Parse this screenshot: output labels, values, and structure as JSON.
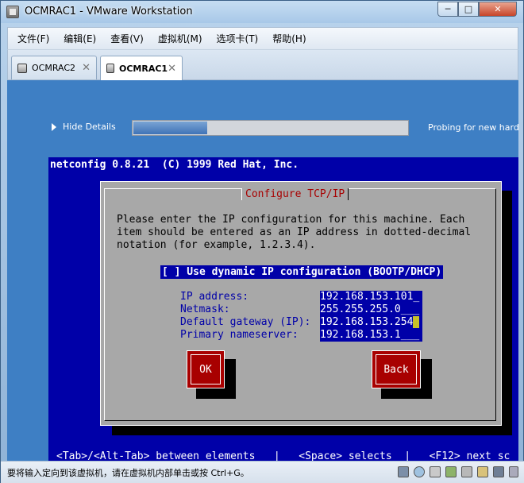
{
  "window": {
    "title": "OCMRAC1 - VMware Workstation",
    "min_glyph": "─",
    "max_glyph": "□",
    "close_glyph": "✕"
  },
  "menu": [
    {
      "label": "文件(F)"
    },
    {
      "label": "编辑(E)"
    },
    {
      "label": "查看(V)"
    },
    {
      "label": "虚拟机(M)"
    },
    {
      "label": "选项卡(T)"
    },
    {
      "label": "帮助(H)"
    }
  ],
  "tabs": [
    {
      "label": "OCMRAC2",
      "active": false,
      "close_glyph": "✕"
    },
    {
      "label": "OCMRAC1",
      "active": true,
      "close_glyph": "✕"
    }
  ],
  "installer": {
    "hide_details_label": "Hide Details",
    "progress_fraction": 0.27,
    "probe_text": "Probing for new hardwa"
  },
  "console": {
    "header": "netconfig 0.8.21  (C) 1999 Red Hat, Inc.",
    "dialog": {
      "title": "Configure TCP/IP",
      "intro": "Please enter the IP configuration for this machine. Each\nitem should be entered as an IP address in dotted-decimal\nnotation (for example, 1.2.3.4).",
      "dhcp_label": "[ ] Use dynamic IP configuration (BOOTP/DHCP)",
      "fields": [
        {
          "label": "IP address:",
          "value": "192.168.153.101_"
        },
        {
          "label": "Netmask:",
          "value": "255.255.255.0___"
        },
        {
          "label": "Default gateway (IP):",
          "value": "192.168.153.254",
          "cursor": " "
        },
        {
          "label": "Primary nameserver:",
          "value": "192.168.153.1___"
        }
      ],
      "ok_label": "OK",
      "back_label": "Back"
    },
    "help_line": "<Tab>/<Alt-Tab> between elements   |   <Space> selects  |   <F12> next sc"
  },
  "statusbar": {
    "text": "要将输入定向到该虚拟机，请在虚拟机内部单击或按 Ctrl+G。"
  },
  "colors": {
    "console_blue": "#0000a8",
    "button_red": "#a80000",
    "dialog_gray": "#a8a8a8",
    "title_red": "#a80000",
    "guest_background": "#3e7fc4"
  }
}
